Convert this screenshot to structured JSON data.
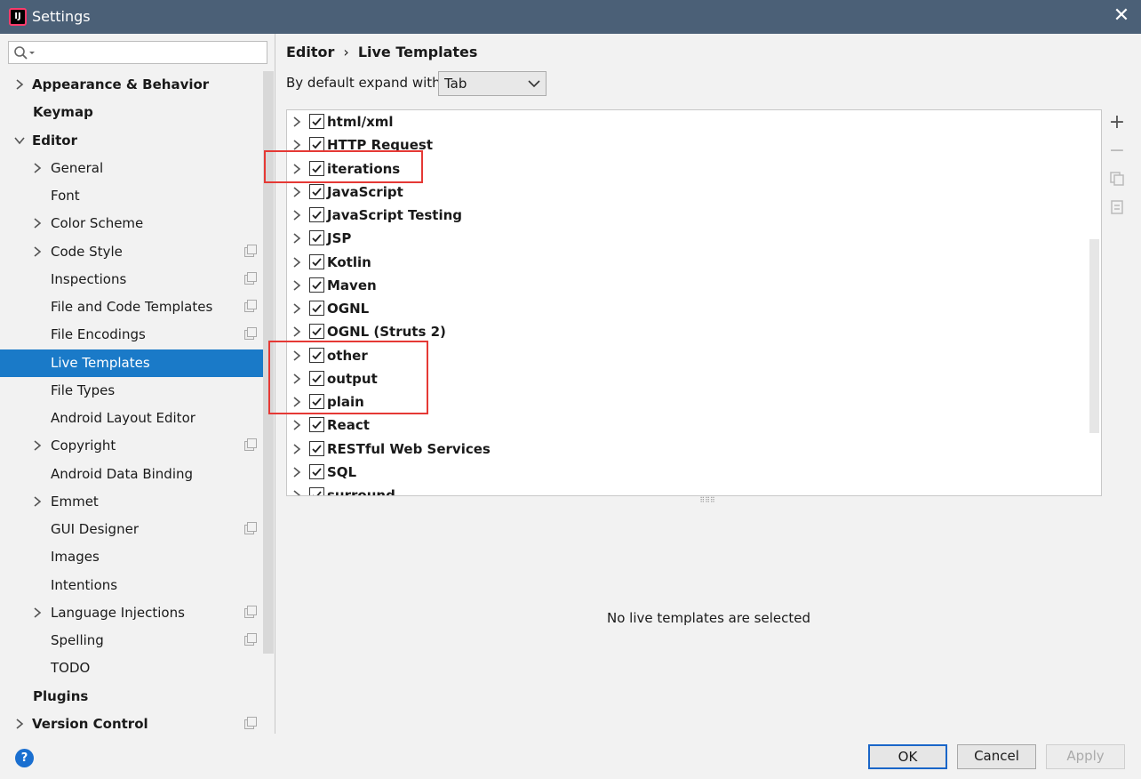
{
  "window": {
    "title": "Settings",
    "close_glyph": "✕"
  },
  "sidebar": {
    "search_placeholder": "",
    "items": [
      {
        "label": "Appearance & Behavior",
        "indent": 0,
        "chevron": true,
        "bold": true
      },
      {
        "label": "Keymap",
        "indent": 0,
        "chevron": false,
        "bold": true
      },
      {
        "label": "Editor",
        "indent": 0,
        "chevron": true,
        "expanded": true,
        "bold": true
      },
      {
        "label": "General",
        "indent": 1,
        "chevron": true
      },
      {
        "label": "Font",
        "indent": 1,
        "chevron": false
      },
      {
        "label": "Color Scheme",
        "indent": 1,
        "chevron": true
      },
      {
        "label": "Code Style",
        "indent": 1,
        "chevron": true,
        "copy_icon": true
      },
      {
        "label": "Inspections",
        "indent": 1,
        "chevron": false,
        "copy_icon": true
      },
      {
        "label": "File and Code Templates",
        "indent": 1,
        "chevron": false,
        "copy_icon": true
      },
      {
        "label": "File Encodings",
        "indent": 1,
        "chevron": false,
        "copy_icon": true
      },
      {
        "label": "Live Templates",
        "indent": 1,
        "chevron": false,
        "selected": true
      },
      {
        "label": "File Types",
        "indent": 1,
        "chevron": false
      },
      {
        "label": "Android Layout Editor",
        "indent": 1,
        "chevron": false
      },
      {
        "label": "Copyright",
        "indent": 1,
        "chevron": true,
        "copy_icon": true
      },
      {
        "label": "Android Data Binding",
        "indent": 1,
        "chevron": false
      },
      {
        "label": "Emmet",
        "indent": 1,
        "chevron": true
      },
      {
        "label": "GUI Designer",
        "indent": 1,
        "chevron": false,
        "copy_icon": true
      },
      {
        "label": "Images",
        "indent": 1,
        "chevron": false
      },
      {
        "label": "Intentions",
        "indent": 1,
        "chevron": false
      },
      {
        "label": "Language Injections",
        "indent": 1,
        "chevron": true,
        "copy_icon": true
      },
      {
        "label": "Spelling",
        "indent": 1,
        "chevron": false,
        "copy_icon": true
      },
      {
        "label": "TODO",
        "indent": 1,
        "chevron": false
      },
      {
        "label": "Plugins",
        "indent": 0,
        "chevron": false,
        "bold": true
      },
      {
        "label": "Version Control",
        "indent": 0,
        "chevron": true,
        "bold": true,
        "copy_icon": true
      }
    ]
  },
  "main": {
    "breadcrumb": {
      "parent": "Editor",
      "separator": "›",
      "current": "Live Templates"
    },
    "expand_label": "By default expand with",
    "expand_value": "Tab",
    "templates": [
      {
        "label": "html/xml",
        "checked": true
      },
      {
        "label": "HTTP Request",
        "checked": true
      },
      {
        "label": "iterations",
        "checked": true
      },
      {
        "label": "JavaScript",
        "checked": true
      },
      {
        "label": "JavaScript Testing",
        "checked": true
      },
      {
        "label": "JSP",
        "checked": true
      },
      {
        "label": "Kotlin",
        "checked": true
      },
      {
        "label": "Maven",
        "checked": true
      },
      {
        "label": "OGNL",
        "checked": true
      },
      {
        "label": "OGNL (Struts 2)",
        "checked": true
      },
      {
        "label": "other",
        "checked": true
      },
      {
        "label": "output",
        "checked": true
      },
      {
        "label": "plain",
        "checked": true
      },
      {
        "label": "React",
        "checked": true
      },
      {
        "label": "RESTful Web Services",
        "checked": true
      },
      {
        "label": "SQL",
        "checked": true
      },
      {
        "label": "surround",
        "checked": true
      }
    ],
    "tools": {
      "add": "+",
      "remove": "−"
    },
    "empty_message": "No live templates are selected"
  },
  "footer": {
    "help": "?",
    "ok": "OK",
    "cancel": "Cancel",
    "apply": "Apply"
  },
  "colors": {
    "selection": "#1a7ac8",
    "titlebar": "#4b6077",
    "highlight": "#e53935"
  }
}
